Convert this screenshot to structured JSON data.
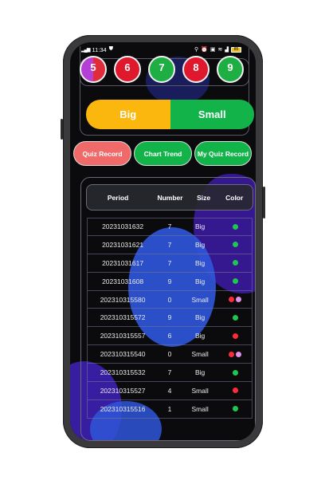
{
  "status": {
    "time": "11:34",
    "battery": "85"
  },
  "balls": [
    {
      "number": "5",
      "color": "#b43fd4",
      "color2": "#e02b3a"
    },
    {
      "number": "6",
      "color": "#e0182d"
    },
    {
      "number": "7",
      "color": "#1fae44"
    },
    {
      "number": "8",
      "color": "#e0182d"
    },
    {
      "number": "9",
      "color": "#1fae44"
    }
  ],
  "bigsmall": {
    "big_label": "Big",
    "big_color": "#fcb70f",
    "small_label": "Small",
    "small_color": "#12b44a"
  },
  "tabs": {
    "quiz_record": "Quiz Record",
    "chart_trend": "Chart Trend",
    "my_quiz_record": "My Quiz Record"
  },
  "table": {
    "headers": {
      "period": "Period",
      "number": "Number",
      "size": "Size",
      "color": "Color"
    },
    "rows": [
      {
        "period": "20231031632",
        "number": "7",
        "size": "Big",
        "colors": [
          "#1ec850"
        ]
      },
      {
        "period": "20231031621",
        "number": "7",
        "size": "Big",
        "colors": [
          "#1ec850"
        ]
      },
      {
        "period": "20231031617",
        "number": "7",
        "size": "Big",
        "colors": [
          "#1ec850"
        ]
      },
      {
        "period": "20231031608",
        "number": "9",
        "size": "Big",
        "colors": [
          "#1ec850"
        ]
      },
      {
        "period": "202310315580",
        "number": "0",
        "size": "Small",
        "colors": [
          "#ff2a3a",
          "#e291e8"
        ]
      },
      {
        "period": "202310315572",
        "number": "9",
        "size": "Big",
        "colors": [
          "#1ec850"
        ]
      },
      {
        "period": "202310315557",
        "number": "6",
        "size": "Big",
        "colors": [
          "#ff2a3a"
        ]
      },
      {
        "period": "202310315540",
        "number": "0",
        "size": "Small",
        "colors": [
          "#ff2a3a",
          "#e291e8"
        ]
      },
      {
        "period": "202310315532",
        "number": "7",
        "size": "Big",
        "colors": [
          "#1ec850"
        ]
      },
      {
        "period": "202310315527",
        "number": "4",
        "size": "Small",
        "colors": [
          "#ff2a3a"
        ]
      },
      {
        "period": "202310315516",
        "number": "1",
        "size": "Small",
        "colors": [
          "#1ec850"
        ]
      }
    ]
  }
}
